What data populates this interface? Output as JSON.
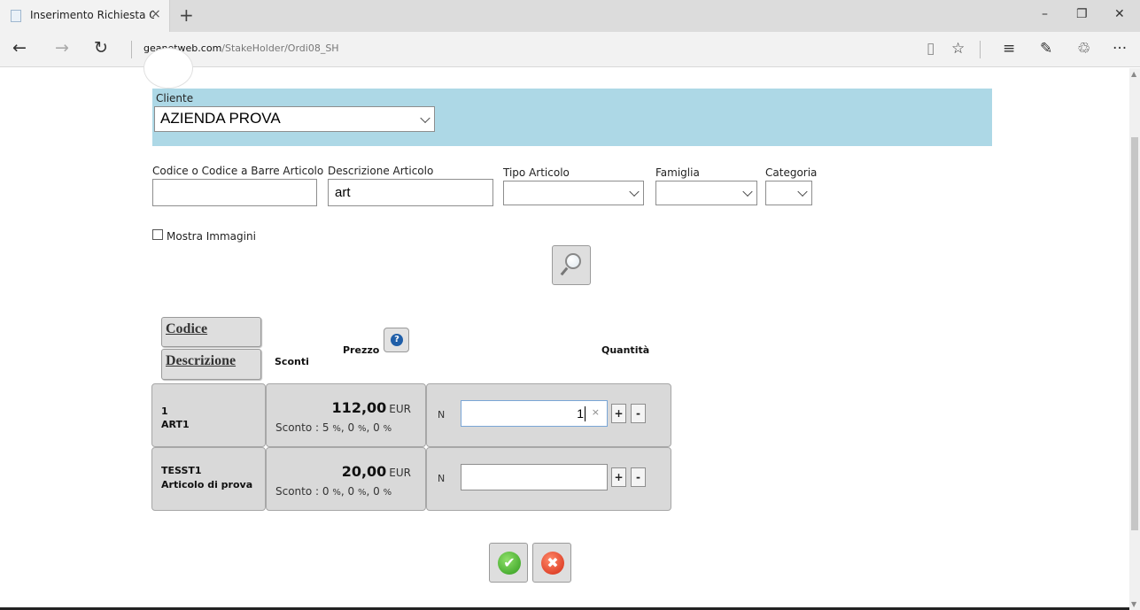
{
  "browser": {
    "tab_title": "Inserimento Richiesta O",
    "tab_close": "×",
    "new_tab": "+",
    "url_domain": "geanetweb.com",
    "url_path": "/StakeHolder/Ordi08_SH",
    "back": "←",
    "forward": "→",
    "refresh": "↻",
    "reading_view": "▯",
    "favorite": "☆",
    "hub": "≡",
    "notes": "✎",
    "share": "♲",
    "more": "···",
    "minimize": "–",
    "restore": "❐",
    "close": "✕"
  },
  "cliente": {
    "label": "Cliente",
    "value": "AZIENDA PROVA"
  },
  "filters": {
    "codice_label": "Codice o Codice a Barre Articolo",
    "codice_value": "",
    "descrizione_label": "Descrizione Articolo",
    "descrizione_value": "art",
    "tipo_label": "Tipo Articolo",
    "famiglia_label": "Famiglia",
    "categoria_label": "Categoria",
    "mostra_immagini": "Mostra Immagini"
  },
  "table": {
    "header_codice": "Codice",
    "header_descrizione": "Descrizione",
    "header_sconti": "Sconti",
    "header_prezzo": "Prezzo",
    "header_quantita": "Quantità",
    "help": "?",
    "rows": [
      {
        "code": "1",
        "name": "ART1",
        "price": "112,00",
        "currency": "EUR",
        "discount_label": "Sconto : ",
        "d1": "5",
        "d2": "0",
        "d3": "0",
        "pct": "%",
        "unit": "N",
        "qty": "1"
      },
      {
        "code": "TESST1",
        "name": "Articolo di prova",
        "price": "20,00",
        "currency": "EUR",
        "discount_label": "Sconto : ",
        "d1": "0",
        "d2": "0",
        "d3": "0",
        "pct": "%",
        "unit": "N",
        "qty": ""
      }
    ],
    "plus": "+",
    "minus": "-",
    "clear": "×"
  },
  "actions": {
    "ok": "✔",
    "cancel": "✖"
  }
}
